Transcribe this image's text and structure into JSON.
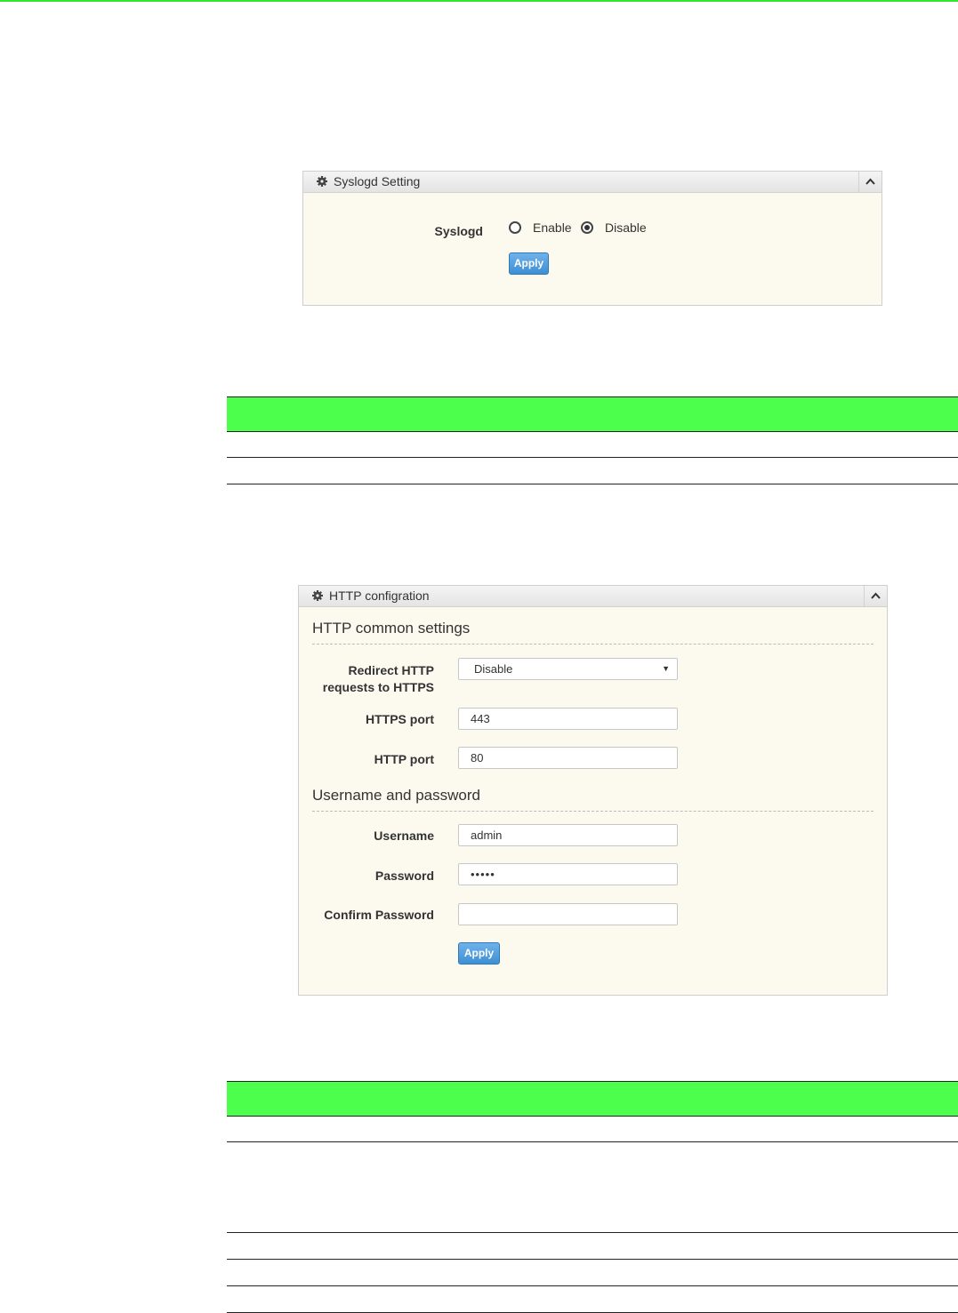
{
  "syslogd_panel": {
    "title": "Syslogd Setting",
    "field_label": "Syslogd",
    "options": [
      {
        "label": "Enable",
        "selected": false
      },
      {
        "label": "Disable",
        "selected": true
      }
    ],
    "apply_label": "Apply"
  },
  "http_panel": {
    "title": "HTTP configration",
    "common_section_title": "HTTP common settings",
    "redirect_label_line1": "Redirect HTTP",
    "redirect_label_line2": "requests to HTTPS",
    "redirect_value": "Disable",
    "https_port_label": "HTTPS port",
    "https_port_value": "443",
    "http_port_label": "HTTP port",
    "http_port_value": "80",
    "credentials_section_title": "Username and password",
    "username_label": "Username",
    "username_value": "admin",
    "password_label": "Password",
    "password_value": "•••••",
    "confirm_password_label": "Confirm Password",
    "confirm_password_value": "",
    "apply_label": "Apply"
  },
  "colors": {
    "accent_green": "#4dff4d",
    "button_blue": "#3d8fd4",
    "panel_background": "#fcfaef"
  }
}
